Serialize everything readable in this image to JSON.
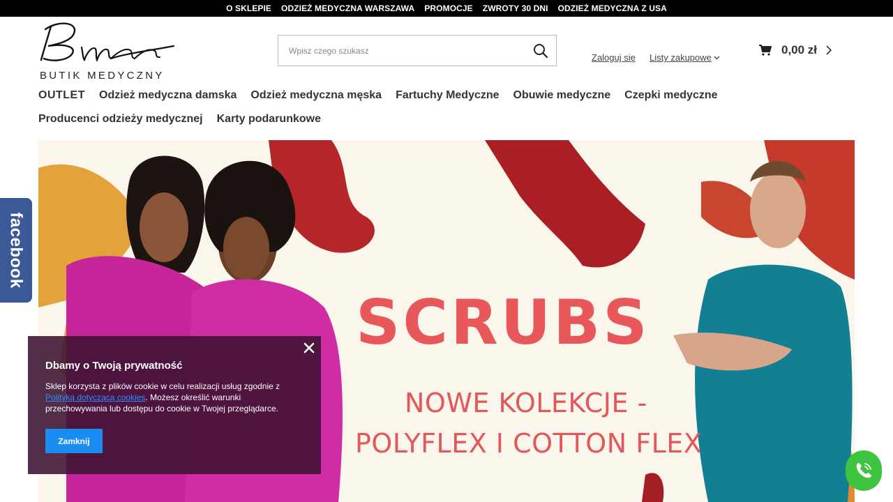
{
  "topbar": {
    "links": [
      "O SKLEPIE",
      "ODZIEŻ MEDYCZNA WARSZAWA",
      "PROMOCJE",
      "ZWROTY 30 DNI",
      "ODZIEŻ MEDYCZNA Z USA"
    ]
  },
  "logo": {
    "text": "BUTIK MEDYCZNY"
  },
  "search": {
    "placeholder": "Wpisz czego szukasz"
  },
  "account": {
    "login": "Zaloguj się",
    "lists": "Listy zakupowe"
  },
  "cart": {
    "total": "0,00 zł"
  },
  "nav": {
    "row1": [
      "OUTLET",
      "Odzież medyczna damska",
      "Odzież medyczna męska",
      "Fartuchy Medyczne",
      "Obuwie medyczne",
      "Czepki medyczne"
    ],
    "row2": [
      "Producenci odzieży medycznej",
      "Karty podarunkowe"
    ]
  },
  "banner": {
    "headline": "SCRUBS",
    "line1": "NOWE KOLEKCJE -",
    "line2": "POLYFLEX I COTTON FLEX"
  },
  "facebook": {
    "label": "facebook"
  },
  "cookie": {
    "title": "Dbamy o Twoją prywatność",
    "text_before": "Sklep korzysta z plików cookie w celu realizacji usług zgodnie z ",
    "link": "Polityką dotyczącą cookies",
    "text_after": ". Możesz określić warunki przechowywania lub dostępu do cookie w Twojej przeglądarce.",
    "button": "Zamknij"
  },
  "colors": {
    "accent": "#e8575a",
    "facebook": "#3b5998",
    "cookie_bg": "#3c1232",
    "button": "#1a8df2",
    "phone": "#3ec43e"
  },
  "icons": [
    "search-icon",
    "chevron-down-icon",
    "cart-icon",
    "chevron-right-icon",
    "close-icon",
    "phone-icon"
  ]
}
